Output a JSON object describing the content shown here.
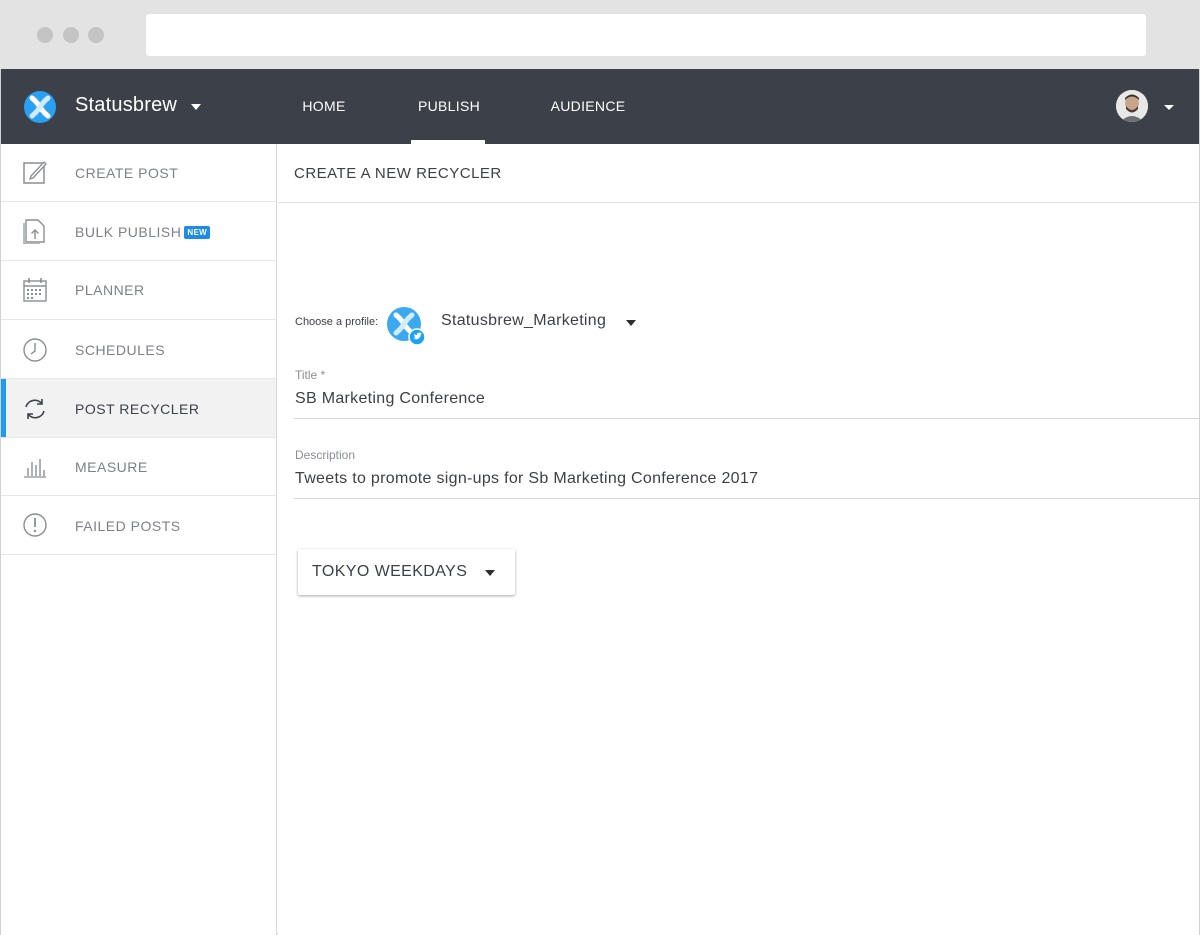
{
  "app": {
    "brand_name": "Statusbrew",
    "logo_icon": "statusbrew-logo-icon"
  },
  "nav": {
    "home": "HOME",
    "publish": "PUBLISH",
    "audience": "AUDIENCE",
    "active": "PUBLISH"
  },
  "sidebar": {
    "items": [
      {
        "label": "CREATE POST",
        "icon": "edit-icon"
      },
      {
        "label": "BULK PUBLISH",
        "icon": "document-upload-icon",
        "badge": "NEW"
      },
      {
        "label": "PLANNER",
        "icon": "calendar-icon"
      },
      {
        "label": "SCHEDULES",
        "icon": "clock-icon"
      },
      {
        "label": "POST RECYCLER",
        "icon": "recycle-icon",
        "active": true
      },
      {
        "label": "MEASURE",
        "icon": "bar-chart-icon"
      },
      {
        "label": "FAILED POSTS",
        "icon": "alert-circle-icon"
      }
    ]
  },
  "main": {
    "title": "CREATE A NEW RECYCLER",
    "profile_label": "Choose a profile:",
    "profile_name": "Statusbrew_Marketing",
    "title_label": "Title *",
    "title_value": "SB Marketing Conference",
    "description_label": "Description",
    "description_value": "Tweets to promote sign-ups for Sb Marketing Conference 2017",
    "schedule": "TOKYO WEEKDAYS"
  },
  "colors": {
    "nav_bg": "#3c4049",
    "accent": "#1e9bf0",
    "chrome_bg": "#e3e3e3"
  }
}
